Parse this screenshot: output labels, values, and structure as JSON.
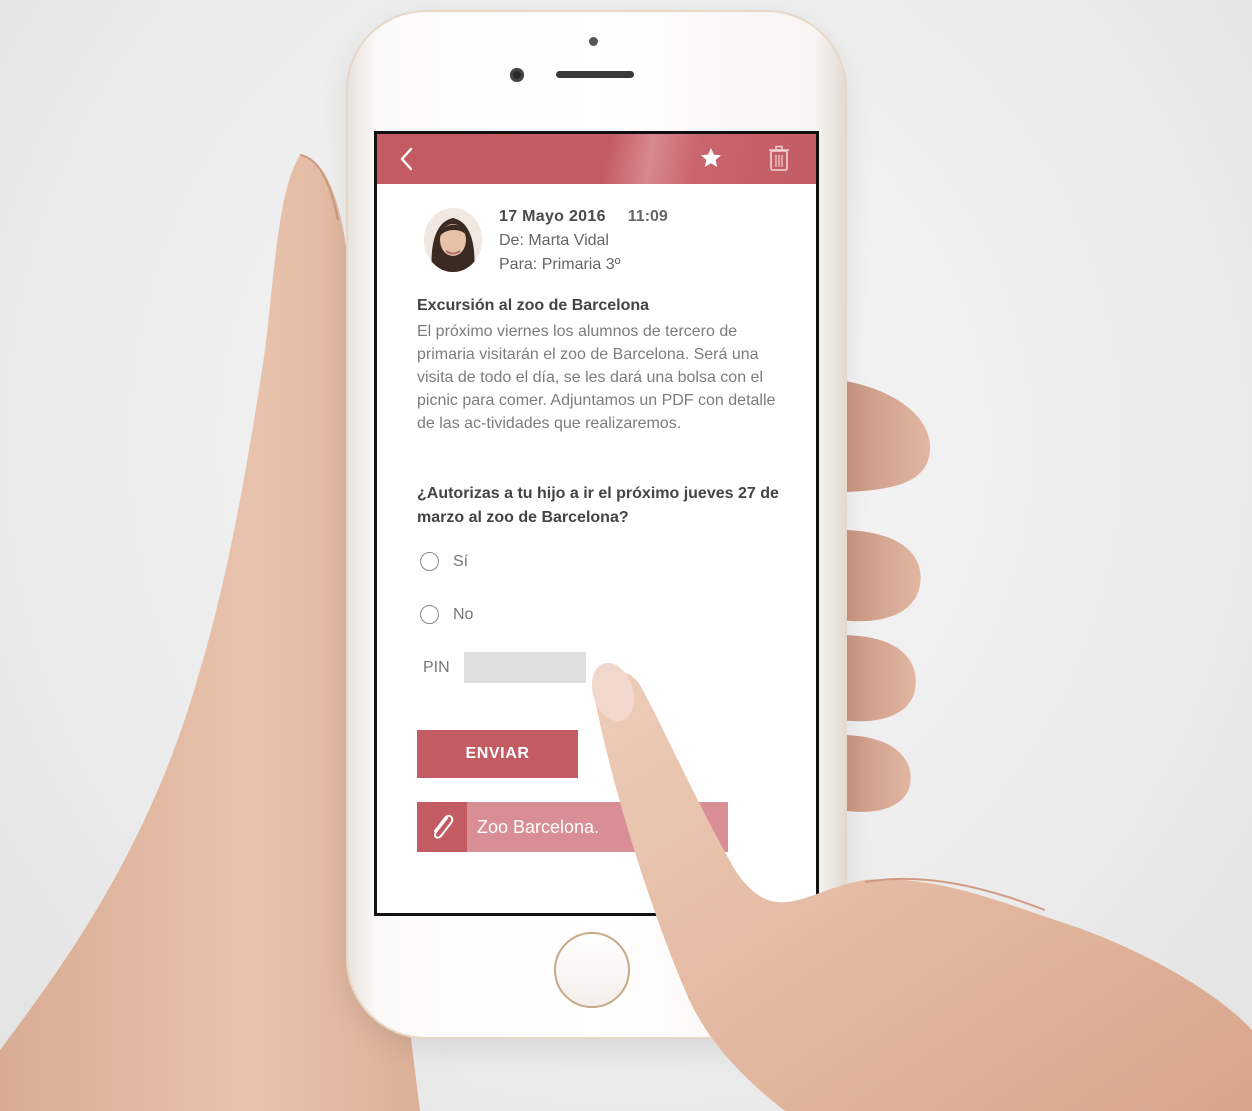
{
  "email": {
    "date": "17 Mayo 2016",
    "time": "11:09",
    "from": "De: Marta Vidal",
    "to": "Para: Primaria 3º",
    "subject": "Excursión al zoo de Barcelona",
    "body": "El próximo viernes los alumnos de tercero de primaria visitarán el zoo de Barcelona. Será una visita de todo el día, se les dará una bolsa con el picnic para comer. Adjuntamos un PDF con detalle de las ac-tividades que realizaremos."
  },
  "form": {
    "question": "¿Autorizas a tu hijo a ir el próximo jueves 27 de marzo al zoo de Barcelona?",
    "option_yes": "Sí",
    "option_no": "No",
    "pin_label": "PIN",
    "send_label": "ENVIAR"
  },
  "attachment": {
    "name": "Zoo Barcelona.",
    "icon": "paperclip-icon"
  },
  "colors": {
    "accent": "#c35b63",
    "accent_light": "#d98d94"
  }
}
